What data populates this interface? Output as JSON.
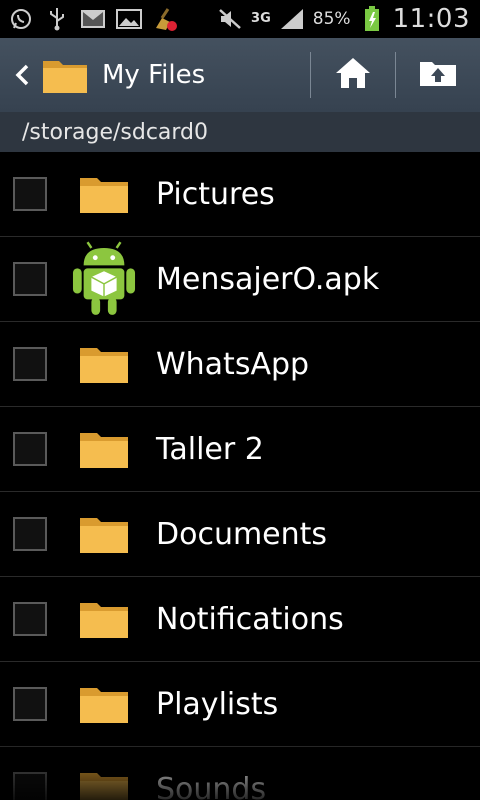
{
  "status_bar": {
    "network": "3G",
    "battery_percent": "85%",
    "time": "11:03",
    "icons": [
      "whatsapp-icon",
      "usb-icon",
      "gmail-icon",
      "gallery-icon",
      "cleaner-icon",
      "mute-icon",
      "signal-icon",
      "battery-charging-icon"
    ]
  },
  "action_bar": {
    "title": "My Files",
    "back_icon": "chevron-left-icon",
    "folder_icon": "folder-icon",
    "home_icon": "home-icon",
    "up_icon": "folder-up-icon"
  },
  "path": "/storage/sdcard0",
  "files": [
    {
      "name": "Pictures",
      "type": "folder"
    },
    {
      "name": "MensajerO.apk",
      "type": "apk"
    },
    {
      "name": "WhatsApp",
      "type": "folder"
    },
    {
      "name": "Taller 2",
      "type": "folder"
    },
    {
      "name": "Documents",
      "type": "folder"
    },
    {
      "name": "Notifications",
      "type": "folder"
    },
    {
      "name": "Playlists",
      "type": "folder"
    },
    {
      "name": "Sounds",
      "type": "folder"
    }
  ],
  "colors": {
    "action_bar": "#3d4957",
    "path_bar": "#2e3640",
    "folder": "#f2b84b",
    "android_green": "#8cc63f",
    "battery_green": "#7ac943"
  }
}
